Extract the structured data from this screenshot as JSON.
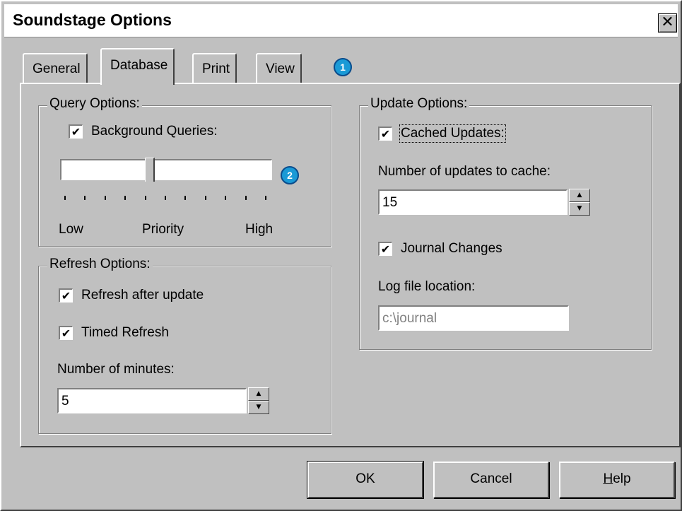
{
  "window": {
    "title": "Soundstage Options",
    "close_glyph": "✕"
  },
  "tabs": [
    {
      "label": "General",
      "active": false
    },
    {
      "label": "Database",
      "active": true
    },
    {
      "label": "Print",
      "active": false
    },
    {
      "label": "View",
      "active": false
    }
  ],
  "callouts": [
    "1",
    "2"
  ],
  "query_options": {
    "legend": "Query Options:",
    "background_queries": {
      "label": "Background Queries:",
      "checked": true
    },
    "priority": {
      "level": 0.42,
      "ticks": 11,
      "low_label": "Low",
      "mid_label": "Priority",
      "high_label": "High"
    }
  },
  "refresh_options": {
    "legend": "Refresh Options:",
    "refresh_after_update": {
      "label": "Refresh after update",
      "checked": true
    },
    "timed_refresh": {
      "label": "Timed Refresh",
      "checked": true
    },
    "minutes_label": "Number of minutes:",
    "minutes_value": "5"
  },
  "update_options": {
    "legend": "Update Options:",
    "cached_updates": {
      "label": "Cached Updates:",
      "checked": true
    },
    "cache_count_label": "Number of updates to cache:",
    "cache_count_value": "15",
    "journal_changes": {
      "label": "Journal Changes",
      "checked": true
    },
    "log_location_label": "Log file location:",
    "log_location_value": "c:\\journal"
  },
  "buttons": {
    "ok": "OK",
    "cancel": "Cancel",
    "help": "Help"
  },
  "colors": {
    "face": "#c0c0c0",
    "callout": "#1a9ad6"
  },
  "icons": {
    "checkmark": "✔",
    "spin_up": "▲",
    "spin_down": "▼"
  }
}
